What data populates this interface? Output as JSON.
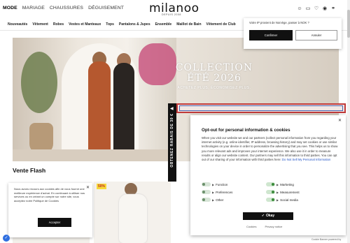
{
  "topnav": [
    "MODE",
    "MARIAGE",
    "CHAUSSURES",
    "DÉGUISEMENT"
  ],
  "logo": {
    "name": "milanoo",
    "sub": "DEPUIS 2008"
  },
  "header_icons": [
    "user-icon",
    "bag-icon",
    "heart-icon",
    "account-icon",
    "globe-icon"
  ],
  "catnav": [
    "Nouveautés",
    "Vêtement",
    "Robes",
    "Vestes et Manteaux",
    "Tops",
    "Pantalons & Jupes",
    "Ensemble",
    "Maillot de Bain",
    "Vêtement de Club"
  ],
  "hero": {
    "line1": "COLLECTION",
    "line2": "ÉTÉ 2026",
    "line3": "ACHETEZ PLUS, ÉCONOMISEZ PLUS."
  },
  "vertical_banner": "OBTENEZ RABAIS DE 30 €",
  "section_title": "Vente Flash",
  "badge": "50%",
  "cookie_small": {
    "text": "Nous avons recours aux cookies afin de vous fournir une meilleure expérience d'achat. En continuant à utiliser nos services ou en créant un compte sur notre site, vous acceptez notre Politique de Cookies",
    "accept": "Accepter"
  },
  "geo_popup": {
    "question": "Votre IP provient de Norvège, passer à NOK ?",
    "confirm": "Confirmer",
    "cancel": "Annuler"
  },
  "opt_out": {
    "title": "Opt-out for personal information & cookies",
    "body": "When you visit our website we and our partners (collect personal information from you regarding your internet activity (e.g. online identifier, IP address, browsing history) and may set cookies or use similar technologies on your device in order to personalize the advertising that you see. This helps us to show you more relevant ads and improves your internet experience. We also use it in order to measure results or align our website content. Our partners may sell this information to third parties. You can opt out of our sharing of your information with third parties here:",
    "link": "Do Not Sell My Personal Information",
    "categories": [
      {
        "label": "Function",
        "on": false
      },
      {
        "label": "Marketing",
        "on": true
      },
      {
        "label": "Preferences",
        "on": false
      },
      {
        "label": "Measurement",
        "on": true
      },
      {
        "label": "Other",
        "on": false
      },
      {
        "label": "Social media",
        "on": true
      }
    ],
    "okay": "Okay",
    "links": [
      "Cookies",
      "Privacy notice"
    ],
    "powered": "Cookie Banner powered by"
  },
  "colors": {
    "accent": "#111111",
    "link": "#2254c5",
    "badge_bg": "#f7d93a",
    "badge_fg": "#c12a2a"
  }
}
